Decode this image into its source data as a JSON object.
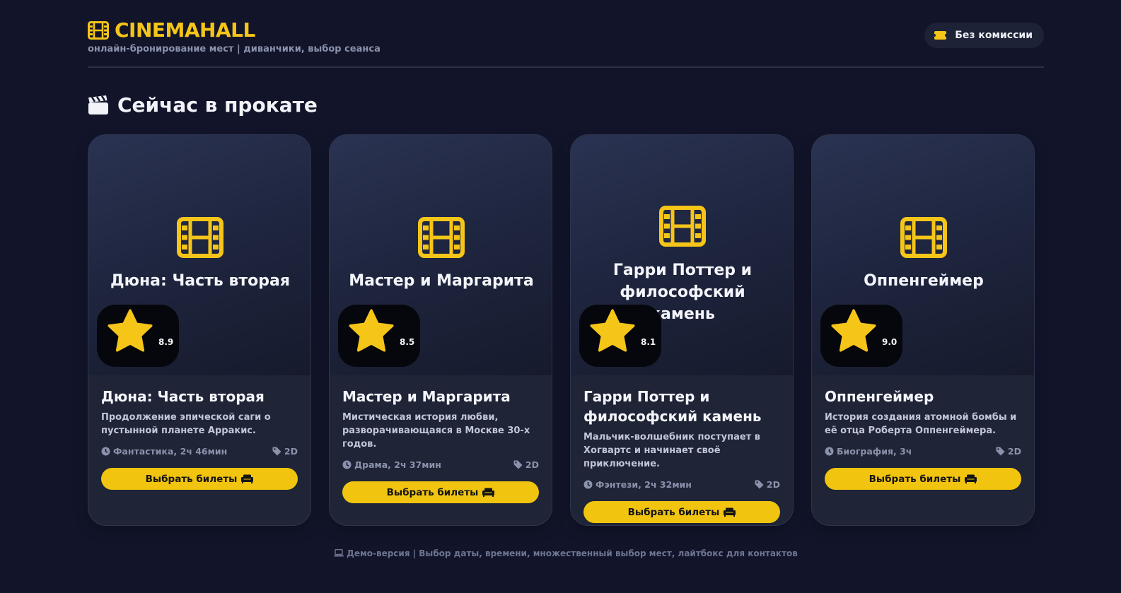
{
  "brand": {
    "name": "CINEMAHALL",
    "tagline": "онлайн-бронирование мест | диванчики, выбор сеанса",
    "accent": "#f5c518"
  },
  "header": {
    "commission_label": "Без комиссии"
  },
  "section": {
    "title": "Сейчас в прокате"
  },
  "movies": [
    {
      "poster_title": "Дюна: Часть вторая",
      "rating": "8.9",
      "title": "Дюна: Часть вторая",
      "description": "Продолжение эпической саги о пустынной планете Арракис.",
      "genre_duration": "Фантастика, 2ч 46мин",
      "format": "2D",
      "button_label": "Выбрать билеты"
    },
    {
      "poster_title": "Мастер и Маргарита",
      "rating": "8.5",
      "title": "Мастер и Маргарита",
      "description": "Мистическая история любви, разворачивающаяся в Москве 30-х годов.",
      "genre_duration": "Драма, 2ч 37мин",
      "format": "2D",
      "button_label": "Выбрать билеты"
    },
    {
      "poster_title": "Гарри Поттер и философский камень",
      "rating": "8.1",
      "title": "Гарри Поттер и философский камень",
      "description": "Мальчик-волшебник поступает в Хогвартс и начинает своё приключение.",
      "genre_duration": "Фэнтези, 2ч 32мин",
      "format": "2D",
      "button_label": "Выбрать билеты"
    },
    {
      "poster_title": "Оппенгеймер",
      "rating": "9.0",
      "title": "Оппенгеймер",
      "description": "История создания атомной бомбы и её отца Роберта Оппенгеймера.",
      "genre_duration": "Биография, 3ч",
      "format": "2D",
      "button_label": "Выбрать билеты"
    }
  ],
  "footer": {
    "text": "Демо-версия | Выбор даты, времени, множественный выбор мест, лайтбокс для контактов"
  },
  "icons": {
    "logo": "film-icon",
    "pill": "ticket-icon",
    "section": "clapperboard-icon",
    "poster": "film-icon",
    "rating": "star-icon",
    "genre": "clock-icon",
    "format": "tag-icon",
    "button": "couch-icon",
    "footer": "laptop-icon"
  }
}
